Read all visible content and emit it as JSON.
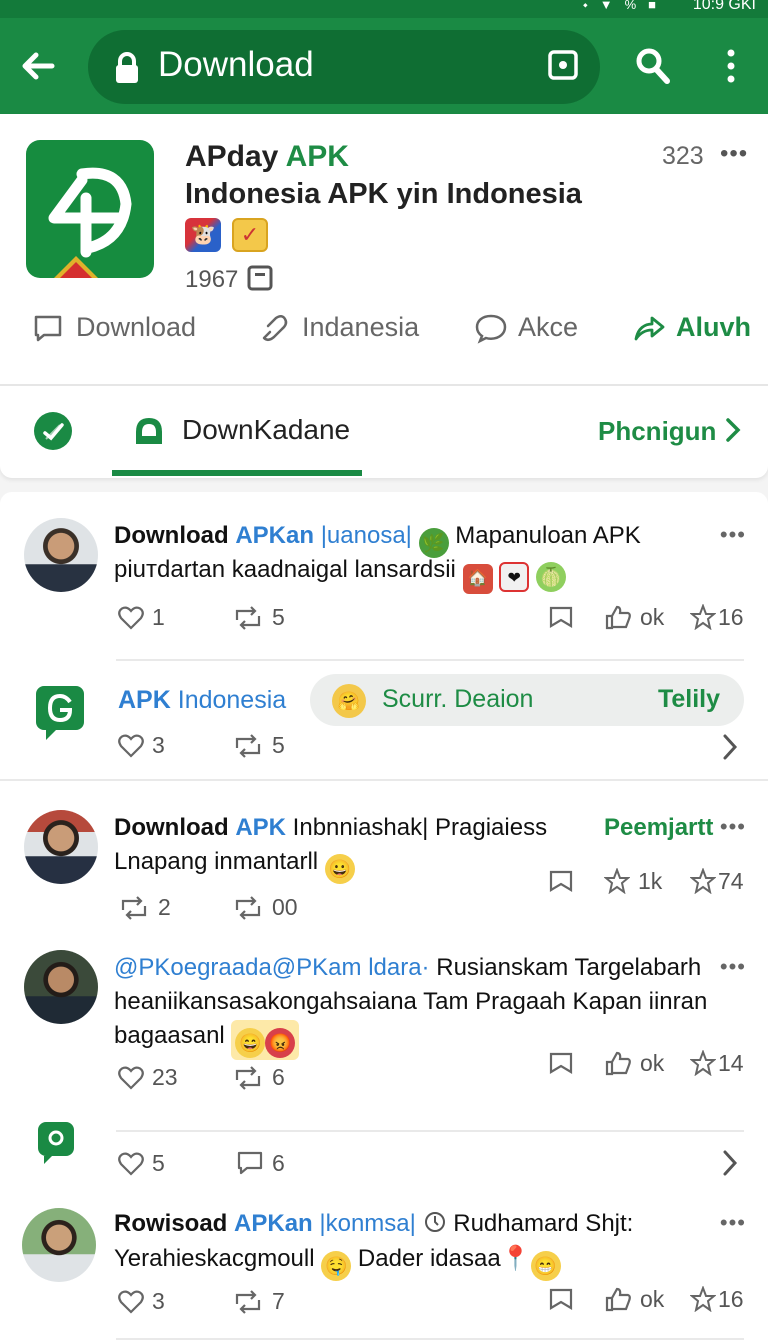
{
  "status_bar": {
    "time": "10:9 GKI"
  },
  "app_bar": {
    "url_text": "Download"
  },
  "app_header": {
    "title_part1": "APday",
    "title_part2": "APK",
    "subtitle": "Indonesia APK yin Indonesia",
    "year": "1967",
    "count": "323",
    "more": "•••",
    "actions": [
      {
        "label": "Download"
      },
      {
        "label": "Indanesia"
      },
      {
        "label": "Akce"
      },
      {
        "label": "Aluvh"
      }
    ]
  },
  "tabs": {
    "active_label": "DownKadane",
    "right_label": "Phcnigun"
  },
  "posts": [
    {
      "author": "Download",
      "tag": "APKan",
      "handle": "|uanosa|",
      "text_line1": "Mapanuloan APK",
      "text_line2": "piuтdartan kaadnaigal lansardsii",
      "likes": "1",
      "reposts": "5",
      "stat_ok": "ok",
      "stars": "16",
      "more": "•••"
    },
    {
      "name_blue": "APK",
      "name_rest": "Indonesia",
      "chip_text": "Scurr. Deaion",
      "chip_right": "Telily",
      "likes": "3",
      "reposts": "5"
    },
    {
      "author": "Download",
      "tag": "APK",
      "text_line1_rest": "Inbnniashak| Pragiaiess",
      "badge": "Peemjartt",
      "text_line2": "Lnapang inmantarll",
      "stat_k": "1k",
      "stars": "74",
      "reposts_a": "2",
      "reposts_b": "00",
      "more": "•••"
    },
    {
      "mentions": "@PKoegraada@PKam ldara·",
      "text_line1_rest": "Rusianskam Targelabarh",
      "text_line2": "heaniikansasakongahsaiana Tam Pragaah Kapan iinran",
      "text_line3": "bagaasanl",
      "likes": "23",
      "reposts": "6",
      "stat_ok": "ok",
      "stars": "14",
      "more": "•••"
    },
    {
      "likes": "5",
      "comments": "6"
    },
    {
      "author": "Rowisoad",
      "tag": "APKan",
      "handle": "|konmsa|",
      "text_line1_rest": "Rudhamard Shjt:",
      "text_line2_a": "Yerahieskacgmoull",
      "text_line2_b": "Dader idasaa",
      "likes": "3",
      "reposts": "7",
      "stat_ok": "ok",
      "stars": "16",
      "more": "•••"
    }
  ]
}
